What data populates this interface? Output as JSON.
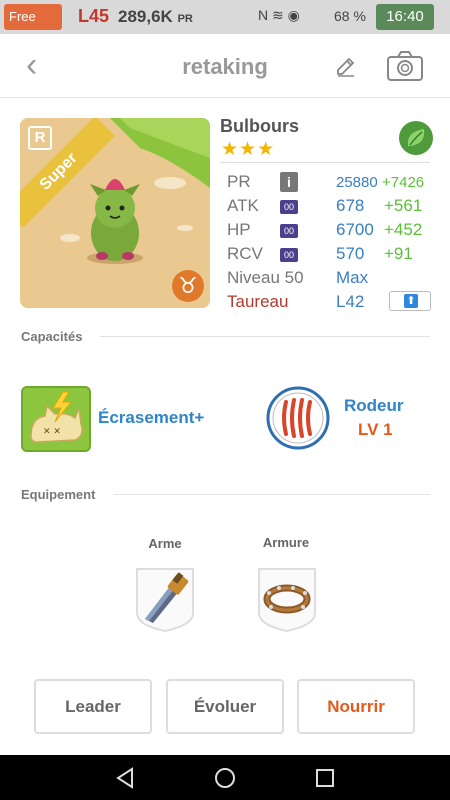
{
  "statusbar": {
    "carrier": "Free",
    "level": "L45",
    "pr_value": "289,6K",
    "pr_unit": "PR",
    "icons": "N ≋ ◉",
    "battery": "68 %",
    "time": "16:40"
  },
  "header": {
    "back_label": "‹",
    "title": "retaking",
    "edit_icon": "pencil-icon",
    "camera_icon": "camera-icon"
  },
  "monster": {
    "rarity_badge": "R",
    "rank_ribbon": "Super",
    "zodiac_symbol": "♉",
    "name": "Bulbours",
    "stars": "★★★",
    "element_icon": "leaf-icon",
    "stats": {
      "pr": {
        "label": "PR",
        "value": "25880",
        "bonus": "+7426"
      },
      "atk": {
        "label": "ATK",
        "chip": "00",
        "value": "678",
        "bonus": "+561"
      },
      "hp": {
        "label": "HP",
        "chip": "00",
        "value": "6700",
        "bonus": "+452"
      },
      "rcv": {
        "label": "RCV",
        "chip": "00",
        "value": "570",
        "bonus": "+91"
      },
      "level": {
        "label": "Niveau 50",
        "value": "Max"
      },
      "sign": {
        "label": "Taureau",
        "value": "L42"
      }
    }
  },
  "abilities": {
    "section_title": "Capacités",
    "skill_name": "Écrasement+",
    "leader_skill_name": "Rodeur",
    "leader_skill_level": "LV 1"
  },
  "equipment": {
    "section_title": "Equipement",
    "weapon_label": "Arme",
    "armor_label": "Armure"
  },
  "actions": {
    "leader": "Leader",
    "evolve": "Évoluer",
    "feed": "Nourrir"
  },
  "colors": {
    "accent_blue": "#2e86c8",
    "accent_orange": "#e55a1c",
    "bonus_green": "#5cbf3a",
    "value_blue": "#3a7fc0"
  }
}
